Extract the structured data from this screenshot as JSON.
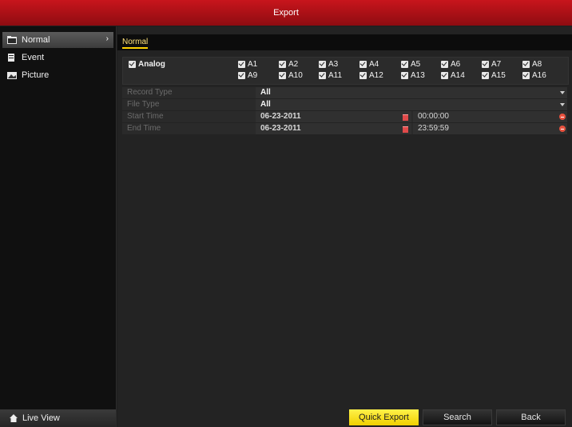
{
  "window": {
    "title": "Export"
  },
  "sidebar": {
    "items": [
      {
        "label": "Normal",
        "icon": "folder-icon",
        "active": true
      },
      {
        "label": "Event",
        "icon": "event-icon",
        "active": false
      },
      {
        "label": "Picture",
        "icon": "picture-icon",
        "active": false
      }
    ],
    "live_view": {
      "label": "Live View",
      "icon": "home-icon"
    }
  },
  "main": {
    "tab": "Normal",
    "analog": {
      "label": "Analog",
      "checked": true
    },
    "channels": [
      "A1",
      "A2",
      "A3",
      "A4",
      "A5",
      "A6",
      "A7",
      "A8",
      "A9",
      "A10",
      "A11",
      "A12",
      "A13",
      "A14",
      "A15",
      "A16"
    ],
    "record_type": {
      "label": "Record Type",
      "value": "All"
    },
    "file_type": {
      "label": "File Type",
      "value": "All"
    },
    "start_time": {
      "label": "Start Time",
      "date": "06-23-2011",
      "time": "00:00:00"
    },
    "end_time": {
      "label": "End Time",
      "date": "06-23-2011",
      "time": "23:59:59"
    }
  },
  "buttons": {
    "quick_export": "Quick Export",
    "search": "Search",
    "back": "Back"
  },
  "colors": {
    "title_red": "#c8151c",
    "accent_yellow": "#ffd200"
  }
}
